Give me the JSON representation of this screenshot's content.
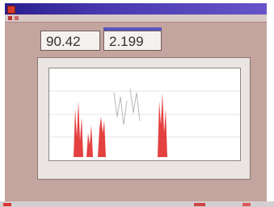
{
  "readouts": {
    "primary_value": "90.42",
    "secondary_value": "2.199"
  },
  "colors": {
    "window_background": "#c4a49e",
    "titlebar": "#3a2fa0",
    "trace": "#e02020",
    "plot_background": "#ffffff"
  },
  "icons": [
    "window-icon"
  ]
}
